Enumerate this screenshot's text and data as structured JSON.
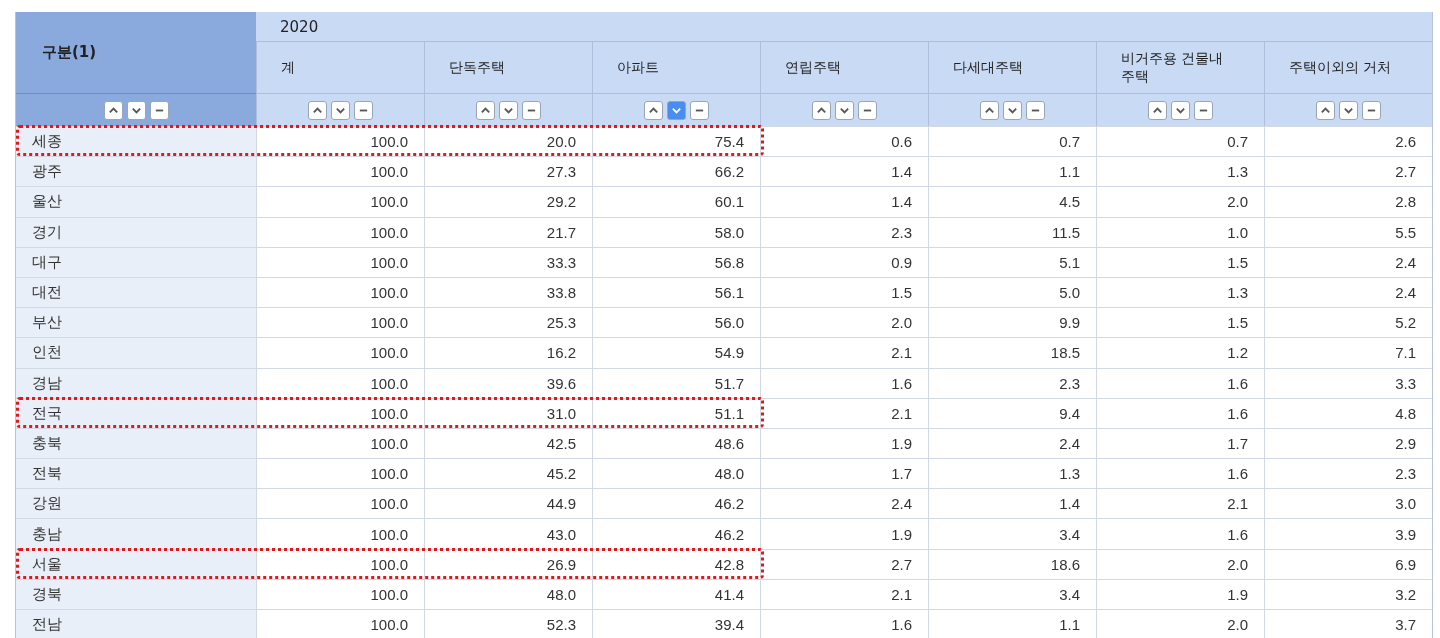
{
  "table": {
    "group_header": "2020",
    "columns": [
      {
        "label": "구분(1)",
        "sort_buttons": [
          {
            "kind": "up",
            "selected": false
          },
          {
            "kind": "down",
            "selected": false
          },
          {
            "kind": "clear",
            "selected": false
          }
        ]
      },
      {
        "label": "계",
        "sort_buttons": [
          {
            "kind": "up",
            "selected": false
          },
          {
            "kind": "down",
            "selected": false
          },
          {
            "kind": "clear",
            "selected": false
          }
        ]
      },
      {
        "label": "단독주택",
        "sort_buttons": [
          {
            "kind": "up",
            "selected": false
          },
          {
            "kind": "down",
            "selected": false
          },
          {
            "kind": "clear",
            "selected": false
          }
        ]
      },
      {
        "label": "아파트",
        "sort_buttons": [
          {
            "kind": "up",
            "selected": false
          },
          {
            "kind": "down",
            "selected": true
          },
          {
            "kind": "clear",
            "selected": false
          }
        ]
      },
      {
        "label": "연립주택",
        "sort_buttons": [
          {
            "kind": "up",
            "selected": false
          },
          {
            "kind": "down",
            "selected": false
          },
          {
            "kind": "clear",
            "selected": false
          }
        ]
      },
      {
        "label": "다세대주택",
        "sort_buttons": [
          {
            "kind": "up",
            "selected": false
          },
          {
            "kind": "down",
            "selected": false
          },
          {
            "kind": "clear",
            "selected": false
          }
        ]
      },
      {
        "label": "비거주용 건물내 주택",
        "sort_buttons": [
          {
            "kind": "up",
            "selected": false
          },
          {
            "kind": "down",
            "selected": false
          },
          {
            "kind": "clear",
            "selected": false
          }
        ]
      },
      {
        "label": "주택이외의 거처",
        "sort_buttons": [
          {
            "kind": "up",
            "selected": false
          },
          {
            "kind": "down",
            "selected": false
          },
          {
            "kind": "clear",
            "selected": false
          }
        ]
      }
    ],
    "rows": [
      {
        "name": "세종",
        "highlighted": true,
        "values": [
          "100.0",
          "20.0",
          "75.4",
          "0.6",
          "0.7",
          "0.7",
          "2.6"
        ]
      },
      {
        "name": "광주",
        "highlighted": false,
        "values": [
          "100.0",
          "27.3",
          "66.2",
          "1.4",
          "1.1",
          "1.3",
          "2.7"
        ]
      },
      {
        "name": "울산",
        "highlighted": false,
        "values": [
          "100.0",
          "29.2",
          "60.1",
          "1.4",
          "4.5",
          "2.0",
          "2.8"
        ]
      },
      {
        "name": "경기",
        "highlighted": false,
        "values": [
          "100.0",
          "21.7",
          "58.0",
          "2.3",
          "11.5",
          "1.0",
          "5.5"
        ]
      },
      {
        "name": "대구",
        "highlighted": false,
        "values": [
          "100.0",
          "33.3",
          "56.8",
          "0.9",
          "5.1",
          "1.5",
          "2.4"
        ]
      },
      {
        "name": "대전",
        "highlighted": false,
        "values": [
          "100.0",
          "33.8",
          "56.1",
          "1.5",
          "5.0",
          "1.3",
          "2.4"
        ]
      },
      {
        "name": "부산",
        "highlighted": false,
        "values": [
          "100.0",
          "25.3",
          "56.0",
          "2.0",
          "9.9",
          "1.5",
          "5.2"
        ]
      },
      {
        "name": "인천",
        "highlighted": false,
        "values": [
          "100.0",
          "16.2",
          "54.9",
          "2.1",
          "18.5",
          "1.2",
          "7.1"
        ]
      },
      {
        "name": "경남",
        "highlighted": false,
        "values": [
          "100.0",
          "39.6",
          "51.7",
          "1.6",
          "2.3",
          "1.6",
          "3.3"
        ]
      },
      {
        "name": "전국",
        "highlighted": true,
        "values": [
          "100.0",
          "31.0",
          "51.1",
          "2.1",
          "9.4",
          "1.6",
          "4.8"
        ]
      },
      {
        "name": "충북",
        "highlighted": false,
        "values": [
          "100.0",
          "42.5",
          "48.6",
          "1.9",
          "2.4",
          "1.7",
          "2.9"
        ]
      },
      {
        "name": "전북",
        "highlighted": false,
        "values": [
          "100.0",
          "45.2",
          "48.0",
          "1.7",
          "1.3",
          "1.6",
          "2.3"
        ]
      },
      {
        "name": "강원",
        "highlighted": false,
        "values": [
          "100.0",
          "44.9",
          "46.2",
          "2.4",
          "1.4",
          "2.1",
          "3.0"
        ]
      },
      {
        "name": "충남",
        "highlighted": false,
        "values": [
          "100.0",
          "43.0",
          "46.2",
          "1.9",
          "3.4",
          "1.6",
          "3.9"
        ]
      },
      {
        "name": "서울",
        "highlighted": true,
        "values": [
          "100.0",
          "26.9",
          "42.8",
          "2.7",
          "18.6",
          "2.0",
          "6.9"
        ]
      },
      {
        "name": "경북",
        "highlighted": false,
        "values": [
          "100.0",
          "48.0",
          "41.4",
          "2.1",
          "3.4",
          "1.9",
          "3.2"
        ]
      },
      {
        "name": "전남",
        "highlighted": false,
        "values": [
          "100.0",
          "52.3",
          "39.4",
          "1.6",
          "1.1",
          "2.0",
          "3.7"
        ]
      }
    ]
  }
}
